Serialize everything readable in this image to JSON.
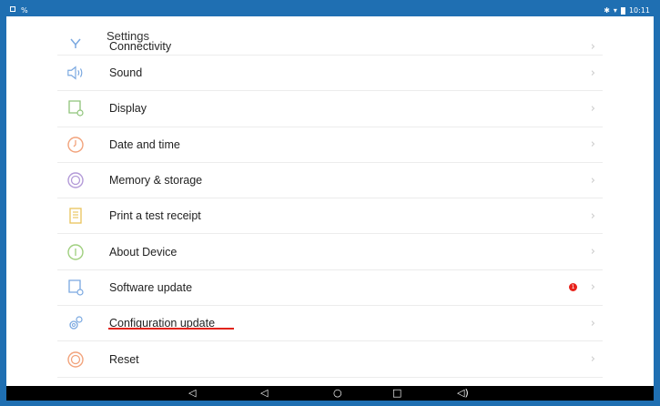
{
  "status_bar": {
    "time": "10:11",
    "left_icons": [
      "image-icon",
      "notification-icon"
    ],
    "right_icons": [
      "bluetooth-icon",
      "wifi-icon",
      "battery-icon"
    ]
  },
  "page": {
    "title": "Settings"
  },
  "settings_items": [
    {
      "label": "Connectivity",
      "icon": "connectivity-icon"
    },
    {
      "label": "Sound",
      "icon": "speaker-icon"
    },
    {
      "label": "Display",
      "icon": "display-icon"
    },
    {
      "label": "Date and time",
      "icon": "clock-icon"
    },
    {
      "label": "Memory & storage",
      "icon": "storage-icon"
    },
    {
      "label": "Print a test receipt",
      "icon": "receipt-icon"
    },
    {
      "label": "About Device",
      "icon": "info-icon"
    },
    {
      "label": "Software update",
      "icon": "software-update-icon",
      "badge": "1"
    },
    {
      "label": "Configuration update",
      "icon": "gear-icon"
    },
    {
      "label": "Reset",
      "icon": "power-icon"
    }
  ],
  "colors": {
    "frame": "#1f6fb2",
    "accent_icon": "#f2a37c",
    "icon_blue": "#7aa8e0",
    "badge": "#e8221b",
    "underline": "#e2231a"
  },
  "nav_bar": [
    "volume-down-icon",
    "back-icon",
    "home-icon",
    "recents-icon",
    "volume-up-icon"
  ]
}
